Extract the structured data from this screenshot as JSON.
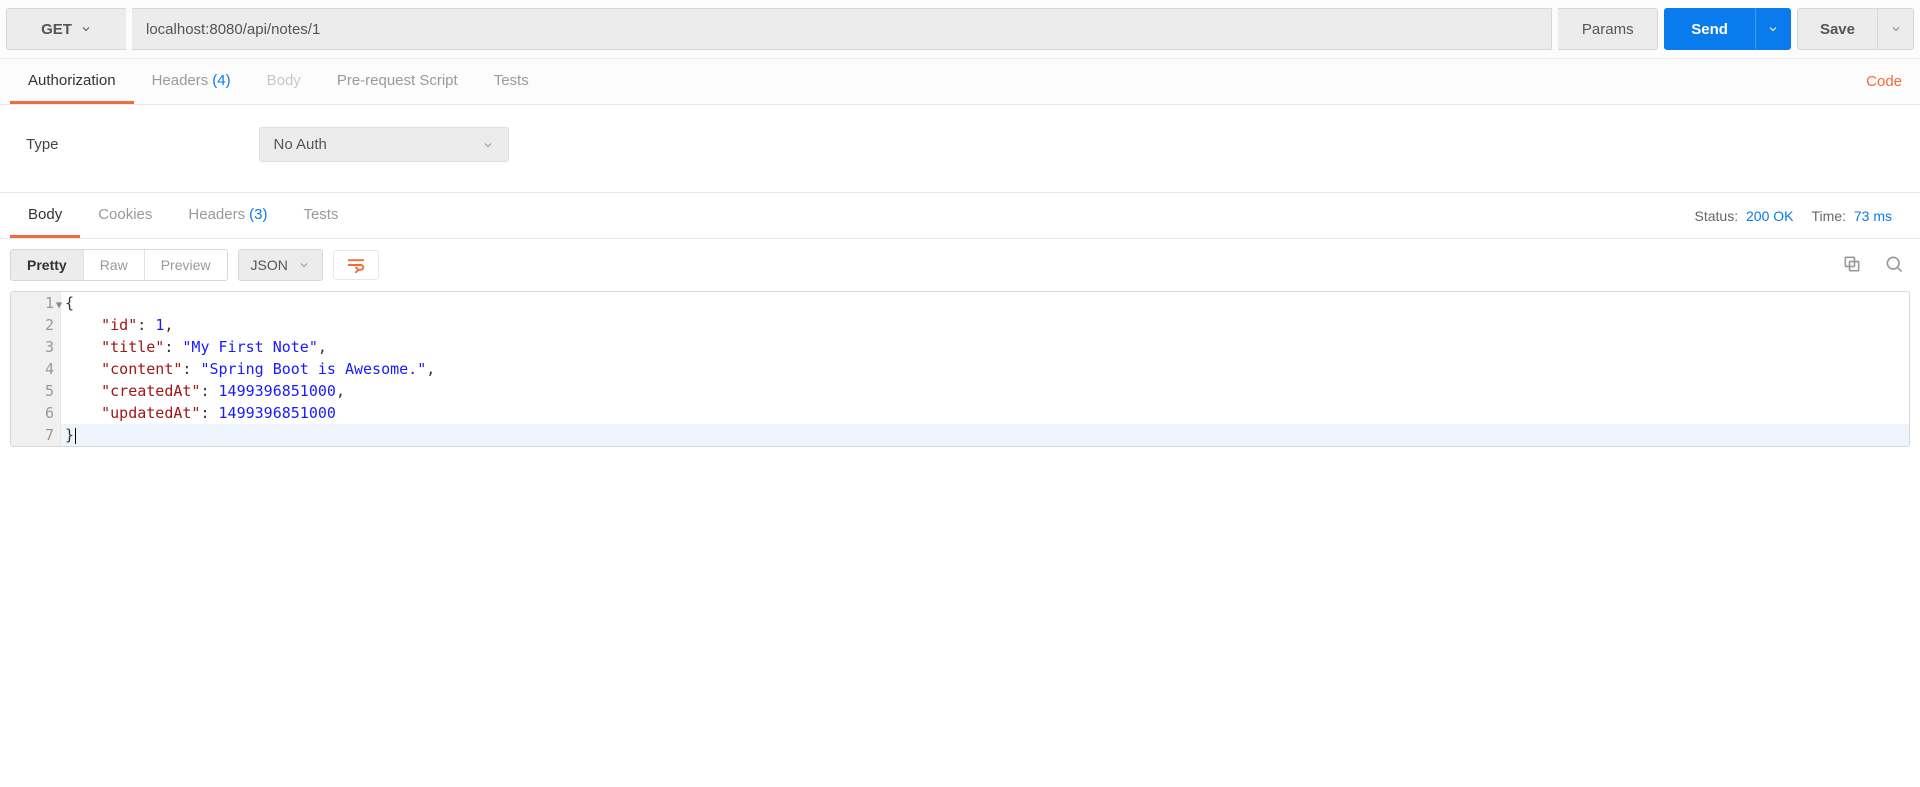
{
  "request": {
    "method": "GET",
    "url": "localhost:8080/api/notes/1",
    "params_label": "Params",
    "send_label": "Send",
    "save_label": "Save"
  },
  "request_tabs": {
    "authorization": "Authorization",
    "headers_label": "Headers",
    "headers_count": "(4)",
    "body": "Body",
    "prerequest": "Pre-request Script",
    "tests": "Tests",
    "code_link": "Code"
  },
  "auth": {
    "type_label": "Type",
    "selected": "No Auth"
  },
  "response_tabs": {
    "body": "Body",
    "cookies": "Cookies",
    "headers_label": "Headers",
    "headers_count": "(3)",
    "tests": "Tests"
  },
  "response_meta": {
    "status_label": "Status:",
    "status_value": "200 OK",
    "time_label": "Time:",
    "time_value": "73 ms"
  },
  "body_toolbar": {
    "pretty": "Pretty",
    "raw": "Raw",
    "preview": "Preview",
    "lang": "JSON"
  },
  "response_body": {
    "lines": [
      "1",
      "2",
      "3",
      "4",
      "5",
      "6",
      "7"
    ],
    "l1": "{",
    "l2_key": "\"id\"",
    "l2_sep": ": ",
    "l2_val": "1",
    "l2_end": ",",
    "l3_key": "\"title\"",
    "l3_sep": ": ",
    "l3_val": "\"My First Note\"",
    "l3_end": ",",
    "l4_key": "\"content\"",
    "l4_sep": ": ",
    "l4_val": "\"Spring Boot is Awesome.\"",
    "l4_end": ",",
    "l5_key": "\"createdAt\"",
    "l5_sep": ": ",
    "l5_val": "1499396851000",
    "l5_end": ",",
    "l6_key": "\"updatedAt\"",
    "l6_sep": ": ",
    "l6_val": "1499396851000",
    "l6_end": "",
    "l7": "}"
  }
}
